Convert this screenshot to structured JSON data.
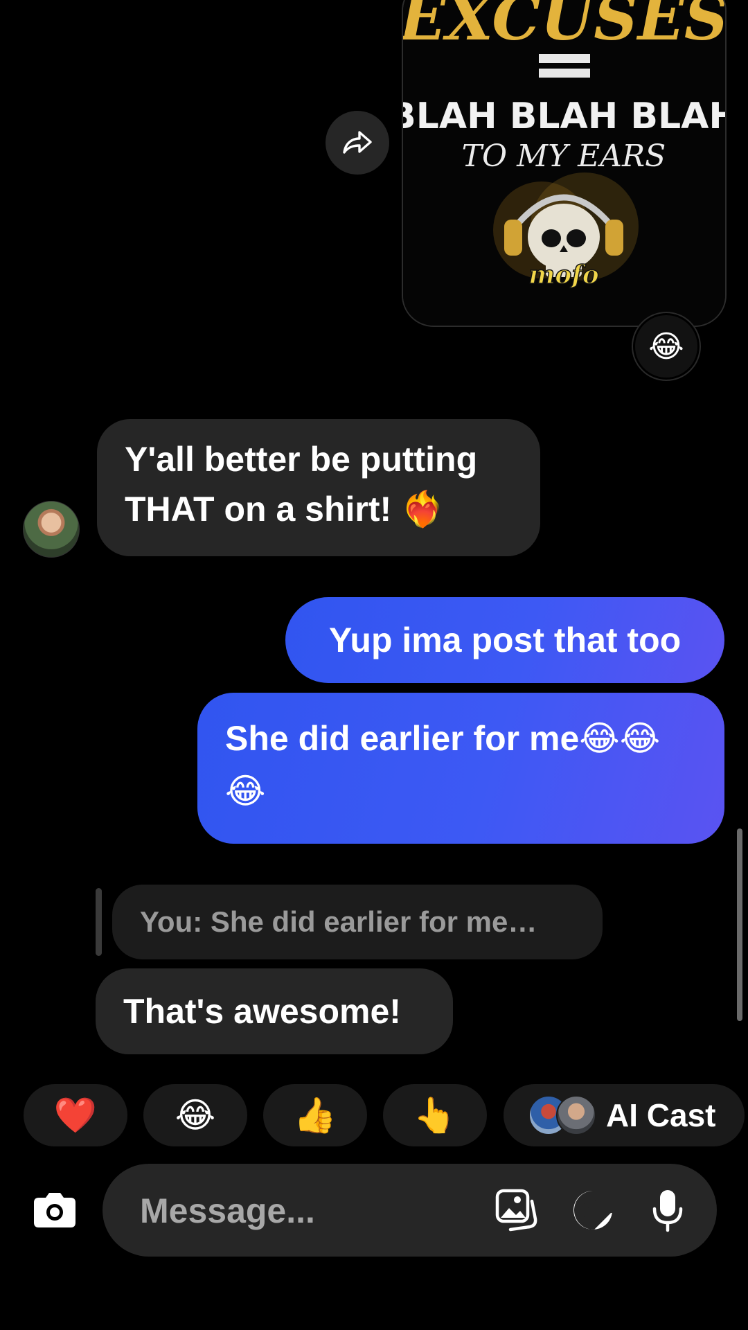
{
  "shared_post": {
    "art_text": {
      "line1": "EXCUSES",
      "line2": "=",
      "line3": "BLAH BLAH BLAH",
      "line4": "TO MY EARS",
      "logo": "mofo"
    },
    "share_icon": "share-arrow-icon",
    "reaction": "😂"
  },
  "messages": [
    {
      "direction": "in",
      "text_line1": "Y'all better be putting",
      "text_line2": "THAT on a shirt! ❤️‍🔥"
    },
    {
      "direction": "out",
      "text": "Yup ima post that too"
    },
    {
      "direction": "out",
      "text_line1": "She did earlier for me😂😂",
      "text_line2": "😂"
    },
    {
      "direction": "in",
      "reply_preview": "You: She did earlier for me…",
      "text": "That's awesome!"
    }
  ],
  "quick_reactions": [
    "❤️",
    "😂",
    "👍",
    "👆"
  ],
  "ai_cast": {
    "label": "AI Cast"
  },
  "composer": {
    "placeholder": "Message...",
    "icons": [
      "camera-icon",
      "gallery-icon",
      "sticker-icon",
      "microphone-icon"
    ]
  },
  "colors": {
    "background": "#000000",
    "incoming_bubble": "#262626",
    "outgoing_start": "#3155f0",
    "outgoing_end": "#5a53f2",
    "art_gold": "#e3b33c"
  }
}
